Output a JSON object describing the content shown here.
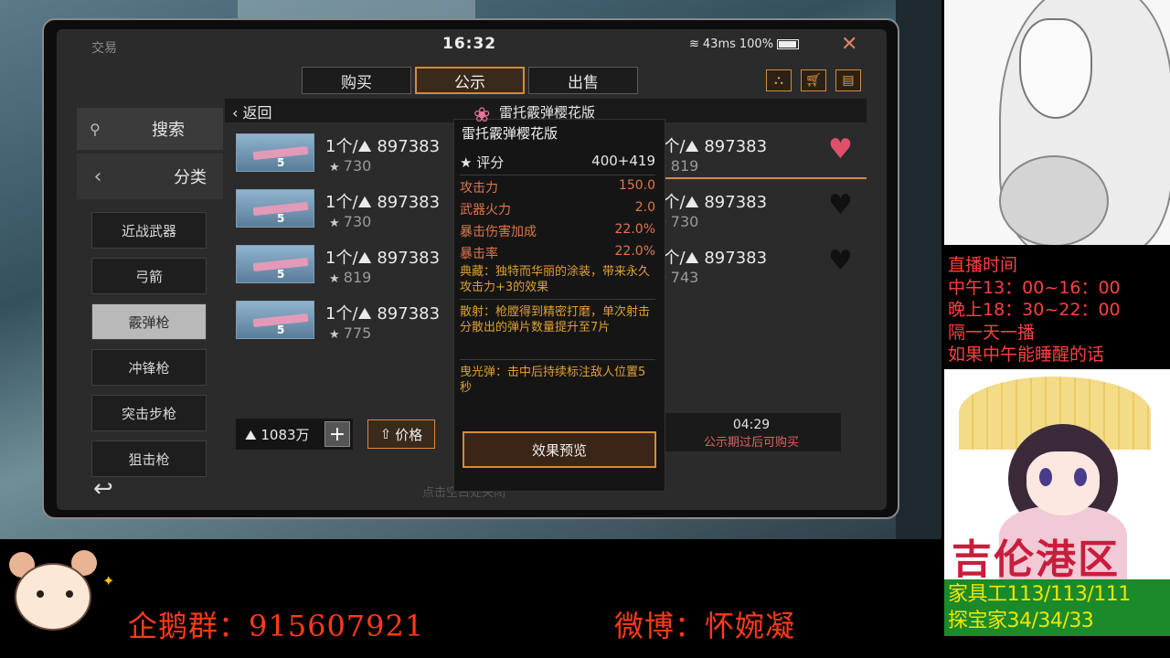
{
  "game": {
    "app_title": "交易",
    "clock": "16:32",
    "latency": "43ms",
    "battery": "100%",
    "tabs": [
      {
        "label": "购买",
        "active": false
      },
      {
        "label": "公示",
        "active": true
      },
      {
        "label": "出售",
        "active": false
      }
    ],
    "search_label": "搜索",
    "category_label": "分类",
    "categories": [
      {
        "label": "近战武器",
        "active": false
      },
      {
        "label": "弓箭",
        "active": false
      },
      {
        "label": "霰弹枪",
        "active": true
      },
      {
        "label": "冲锋枪",
        "active": false
      },
      {
        "label": "突击步枪",
        "active": false
      },
      {
        "label": "狙击枪",
        "active": false
      }
    ],
    "back_label": "返回",
    "listing_title": "雷托霰弹樱花版",
    "listings_left": [
      {
        "qty_price": "1个/⛰ 897383",
        "level": "5",
        "score": "730"
      },
      {
        "qty_price": "1个/⛰ 897383",
        "level": "5",
        "score": "730"
      },
      {
        "qty_price": "1个/⛰ 897383",
        "level": "5",
        "score": "819"
      },
      {
        "qty_price": "1个/⛰ 897383",
        "level": "5",
        "score": "775"
      }
    ],
    "listings_right": [
      {
        "qty_price": "1个/⛰ 897383",
        "score": "819",
        "favorited": true
      },
      {
        "qty_price": "1个/⛰ 897383",
        "score": "730",
        "favorited": false
      },
      {
        "qty_price": "1个/⛰ 897383",
        "score": "743",
        "favorited": false
      }
    ],
    "balance": "1083万",
    "sort_label": "价格",
    "timer": "04:29",
    "timer_note": "公示期过后可购买",
    "close_hint": "点击空白处关闭",
    "colors": {
      "accent": "#d58a3e",
      "stat": "#e0764d",
      "effect": "#e0a030",
      "heart_active": "#e0506a"
    }
  },
  "tooltip": {
    "name": "雷托霰弹樱花版",
    "rating_label": "评分",
    "rating_value": "400+419",
    "stats": [
      {
        "label": "攻击力",
        "value": "150.0"
      },
      {
        "label": "武器火力",
        "value": "2.0"
      },
      {
        "label": "暴击伤害加成",
        "value": "22.0%"
      },
      {
        "label": "暴击率",
        "value": "22.0%"
      }
    ],
    "effects": [
      "典藏：独特而华丽的涂装，带来永久攻击力+3的效果",
      "散射：枪膛得到精密打磨，单次射击分散出的弹片数量提升至7片",
      "曳光弹：击中后持续标注敌人位置5秒"
    ],
    "preview_button": "效果预览"
  },
  "overlay": {
    "schedule": [
      "直播时间",
      "中午13：00~16：00",
      "晚上18：30~22：00",
      "隔一天一播",
      "如果中午能睡醒的话"
    ],
    "brand": "吉伦港区",
    "stats": [
      "家具工113/113/111",
      "探宝家34/34/33"
    ],
    "qq_group": "企鹅群：915607921",
    "weibo": "微博：怀婉凝"
  }
}
